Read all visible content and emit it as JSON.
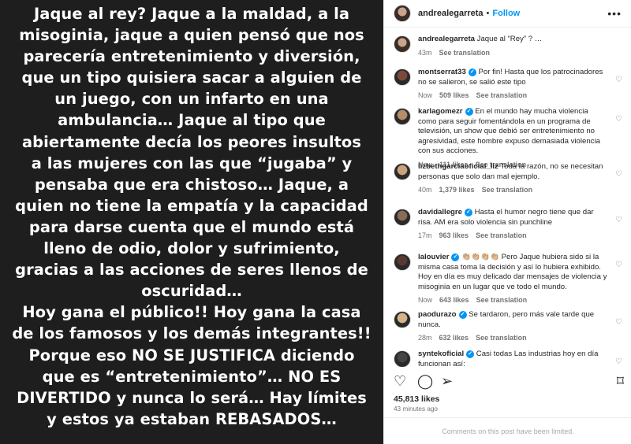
{
  "post_image": {
    "lines": [
      "Jaque al rey? Jaque a la maldad, a la",
      "misoginia, jaque a quien pensó que nos",
      "parecería entretenimiento y diversión,",
      "que un tipo quisiera sacar a alguien de",
      "un juego, con un infarto en una",
      "ambulancia… Jaque al tipo que",
      "abiertamente decía los peores insultos",
      "a las mujeres con las que  “jugaba”   y",
      "pensaba que era chistoso… Jaque, a",
      "quien no tiene la empatía y la capacidad",
      "para darse cuenta que el mundo está",
      "lleno de  odio, dolor y sufrimiento,",
      "gracias a las acciones de seres llenos de",
      "oscuridad…",
      "Hoy gana el público!!  Hoy gana la casa",
      "de los famosos y los demás integrantes!!",
      "Porque eso NO SE JUSTIFICA diciendo",
      "que es “entretenimiento”… NO ES",
      "DIVERTIDO y nunca lo será… Hay límites",
      "y estos ya estaban REBASADOS…"
    ]
  },
  "header": {
    "username": "andrealegarreta",
    "separator": "•",
    "follow_label": "Follow",
    "more_icon": "more-horizontal-icon"
  },
  "caption": {
    "username": "andrealegarreta",
    "text": "Jaque al “Rey” ? …",
    "time": "43m",
    "see_translation": "See translation"
  },
  "comments": [
    {
      "username": "montserrat33",
      "verified": true,
      "text": "Por fin! Hasta que los patrocinadores no se salieron, se salió este tipo",
      "time": "Now",
      "likes": "509 likes",
      "translation": "See translation",
      "avatar_color": "#7a4a3a"
    },
    {
      "username": "karlagomezr",
      "verified": true,
      "text": "En el mundo hay mucha violencia como para seguir fomentándola en un programa de televisión, un show que debió ser entretenimiento no agresividad, este hombre expuso demasiada violencia con sus acciones.",
      "time": "Now",
      "likes": "111 likes",
      "translation": "See translation",
      "avatar_color": "#b58d6a"
    },
    {
      "username": "lizbethgarciaoficial_liz",
      "verified": false,
      "text": "Toda la razón, no se necesitan personas que solo dan mal ejemplo.",
      "time": "40m",
      "likes": "1,379 likes",
      "translation": "See translation",
      "avatar_color": "#caa37c"
    },
    {
      "username": "davidallegre",
      "verified": true,
      "text": "Hasta el humor negro tiene que dar risa. AM era solo violencia sin punchline",
      "time": "17m",
      "likes": "963 likes",
      "translation": "See translation",
      "avatar_color": "#8a6b55"
    },
    {
      "username": "lalouvier",
      "verified": true,
      "text": "👏🏼👏🏼👏🏼👏🏼 Pero Jaque hubiera sido si la misma casa toma la decisión y así lo hubiera exhibido. Hoy en día es muy delicado dar mensajes de violencia y misoginia en un lugar que ve todo el mundo.",
      "time": "Now",
      "likes": "643 likes",
      "translation": "See translation",
      "avatar_color": "#5a3a30"
    },
    {
      "username": "paodurazo",
      "verified": true,
      "text": "Se tardaron, pero más vale tarde que nunca.",
      "time": "28m",
      "likes": "632 likes",
      "translation": "See translation",
      "avatar_color": "#d6b48a"
    },
    {
      "username": "syntekoficial",
      "verified": true,
      "text": "Casi todas Las industrias hoy en día funcionan así:",
      "time": "",
      "likes": "",
      "translation": "",
      "avatar_color": "#444444"
    }
  ],
  "actions": {
    "like_icon": "heart-icon",
    "comment_icon": "comment-icon",
    "share_icon": "share-icon",
    "save_icon": "bookmark-icon"
  },
  "likes_count": "45,813 likes",
  "time_ago": "43 minutes ago",
  "footer_text": "Comments on this post have been limited."
}
